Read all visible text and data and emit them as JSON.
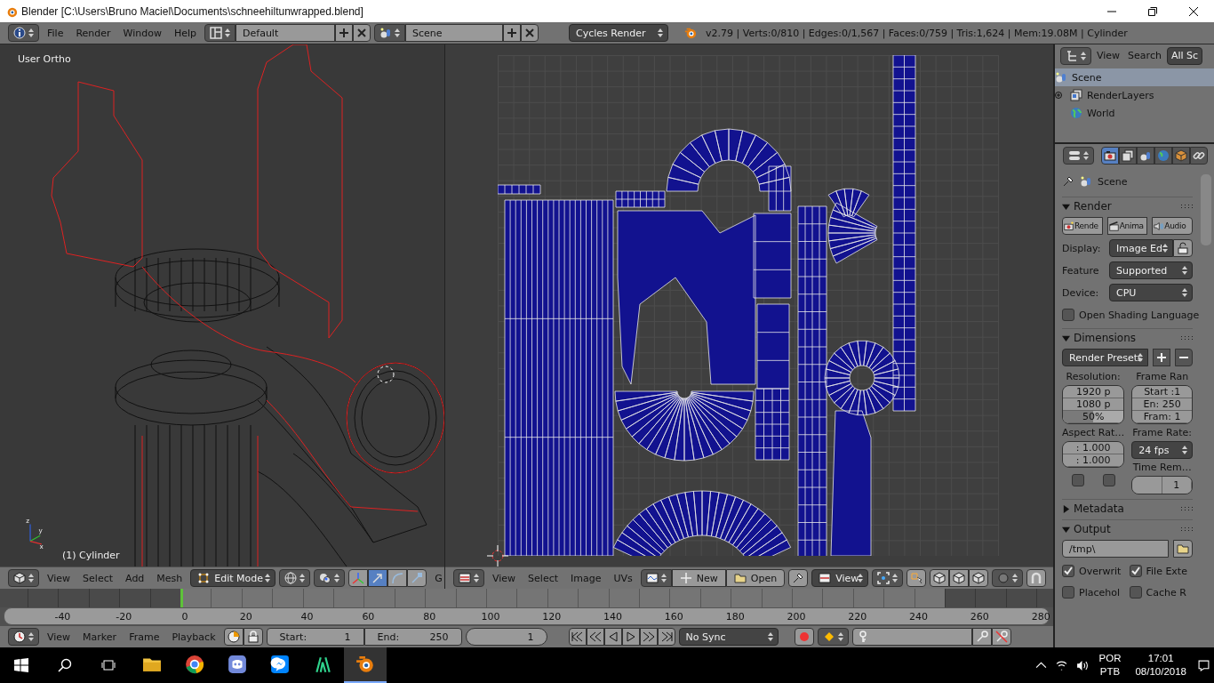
{
  "window": {
    "title": "Blender [C:\\Users\\Bruno Maciel\\Documents\\schneehiltunwrapped.blend]"
  },
  "info_header": {
    "menus": [
      "File",
      "Render",
      "Window",
      "Help"
    ],
    "layout": "Default",
    "scene": "Scene",
    "engine": "Cycles Render",
    "stats": "v2.79 | Verts:0/810 | Edges:0/1,567 | Faces:0/759 | Tris:1,624 | Mem:19.08M | Cylinder"
  },
  "viewport_3d": {
    "view_label": "User Ortho",
    "object_label": "(1) Cylinder",
    "axis_labels": [
      "z",
      "y",
      "x"
    ],
    "menus": [
      "View",
      "Select",
      "Add",
      "Mesh"
    ],
    "mode": "Edit Mode",
    "manipulators": [
      {
        "kind": "axes",
        "selected": false
      },
      {
        "kind": "translate",
        "selected": true
      },
      {
        "kind": "rotate",
        "selected": false
      },
      {
        "kind": "scale",
        "selected": false
      }
    ],
    "cut_label": "G"
  },
  "uv_editor": {
    "menus": [
      "View",
      "Select",
      "Image",
      "UVs"
    ],
    "new_button": "New",
    "open_button": "Open",
    "view_dropdown": "View"
  },
  "outliner": {
    "menus": [
      "View",
      "Search"
    ],
    "filter": "All Sc",
    "items": [
      {
        "kind": "scene",
        "label": "Scene",
        "selected": true
      },
      {
        "kind": "layers",
        "label": "RenderLayers",
        "selected": false
      },
      {
        "kind": "world",
        "label": "World",
        "selected": false
      }
    ]
  },
  "properties": {
    "tabs": [
      {
        "kind": "render",
        "selected": true
      },
      {
        "kind": "layers",
        "selected": false
      },
      {
        "kind": "scene",
        "selected": false
      },
      {
        "kind": "world",
        "selected": false
      },
      {
        "kind": "object",
        "selected": false
      },
      {
        "kind": "constraints",
        "selected": false
      }
    ],
    "context": "Scene",
    "render": {
      "title": "Render",
      "expanded": true,
      "buttons": [
        "Rende",
        "Anima",
        "Audio"
      ],
      "display_label": "Display:",
      "display": "Image Ed",
      "feature_label": "Feature",
      "feature": "Supported",
      "device_label": "Device:",
      "device": "CPU",
      "osl": {
        "label": "Open Shading Language",
        "checked": false
      }
    },
    "dimensions": {
      "title": "Dimensions",
      "expanded": true,
      "presets": "Render Presets",
      "resolution_label": "Resolution:",
      "res_x": "1920 p",
      "res_y": "1080 p",
      "res_pct": {
        "text": "50%",
        "level": 0.5
      },
      "frame_range_label": "Frame Ran",
      "start": "Start :1",
      "end": "En: 250",
      "step": "Fram: 1",
      "aspect_label": "Aspect Rat…",
      "aspect_x": ": 1.000",
      "aspect_y": ": 1.000",
      "border_checked": false,
      "crop_checked": false,
      "frame_rate_label": "Frame Rate:",
      "frame_rate": "24 fps",
      "time_remap_label": "Time Rem…",
      "time_remap_new": "1"
    },
    "metadata": {
      "title": "Metadata",
      "expanded": false
    },
    "output": {
      "title": "Output",
      "expanded": true,
      "path": "/tmp\\",
      "checks": [
        {
          "label": "Overwrit",
          "checked": true
        },
        {
          "label": "File Exte",
          "checked": true
        },
        {
          "label": "Placehol",
          "checked": false
        },
        {
          "label": "Cache R",
          "checked": false
        }
      ]
    }
  },
  "timeline": {
    "ruler": [
      "-40",
      "-20",
      "0",
      "20",
      "40",
      "60",
      "80",
      "100",
      "120",
      "140",
      "160",
      "180",
      "200",
      "220",
      "240",
      "260",
      "280"
    ],
    "menus": [
      "View",
      "Marker",
      "Frame",
      "Playback"
    ],
    "start_label": "Start:",
    "start": "1",
    "end_label": "End:",
    "end": "250",
    "current": "1",
    "sync": "No Sync"
  },
  "taskbar": {
    "apps": [
      {
        "kind": "folder",
        "selected": false
      },
      {
        "kind": "browser",
        "selected": false
      },
      {
        "kind": "chat",
        "selected": false
      },
      {
        "kind": "messenger",
        "selected": false
      },
      {
        "kind": "paint",
        "selected": false
      },
      {
        "kind": "blender",
        "selected": true
      }
    ],
    "language": "POR",
    "keyboard": "PTB",
    "time": "17:01",
    "date": "08/10/2018"
  }
}
